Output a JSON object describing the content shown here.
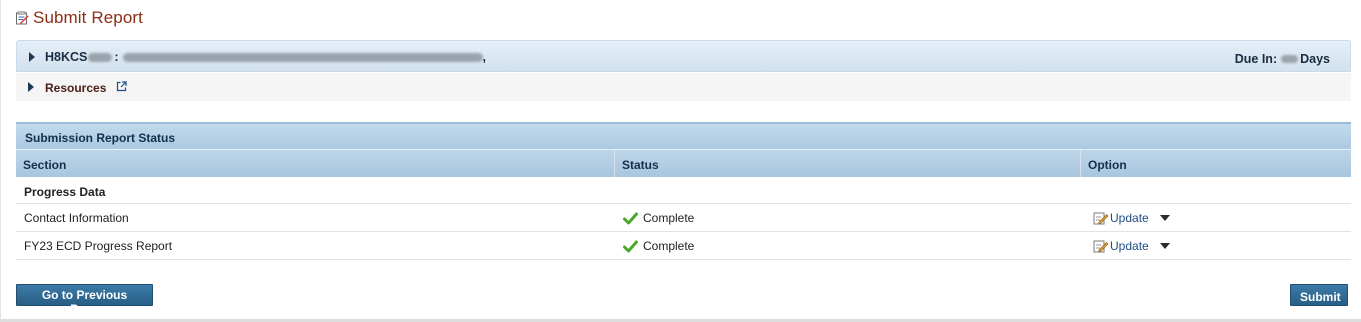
{
  "page": {
    "title": "Submit Report",
    "title_icon": "report-edit-icon"
  },
  "grant": {
    "prefix": "H8KCS",
    "separator": ":",
    "trail": ",",
    "due_label": "Due In:",
    "due_unit": "Days",
    "expand_icon": "triangle-right-icon"
  },
  "resources": {
    "label": "Resources",
    "icon": "external-link-icon"
  },
  "status_table": {
    "caption": "Submission Report Status",
    "columns": [
      "Section",
      "Status",
      "Option"
    ],
    "group": "Progress Data",
    "rows": [
      {
        "section": "Contact Information",
        "status": "Complete",
        "status_icon": "check-icon",
        "option": "Update",
        "option_icon": "edit-icon"
      },
      {
        "section": "FY23 ECD Progress Report",
        "status": "Complete",
        "status_icon": "check-icon",
        "option": "Update",
        "option_icon": "edit-icon"
      }
    ]
  },
  "buttons": {
    "previous": "Go to Previous Page",
    "submit": "Submit"
  },
  "colors": {
    "title": "#8b2e16",
    "header_blue": "#abc9e1",
    "button_blue": "#285e85",
    "check_green": "#4aa82a",
    "link_blue": "#1e4d84"
  }
}
